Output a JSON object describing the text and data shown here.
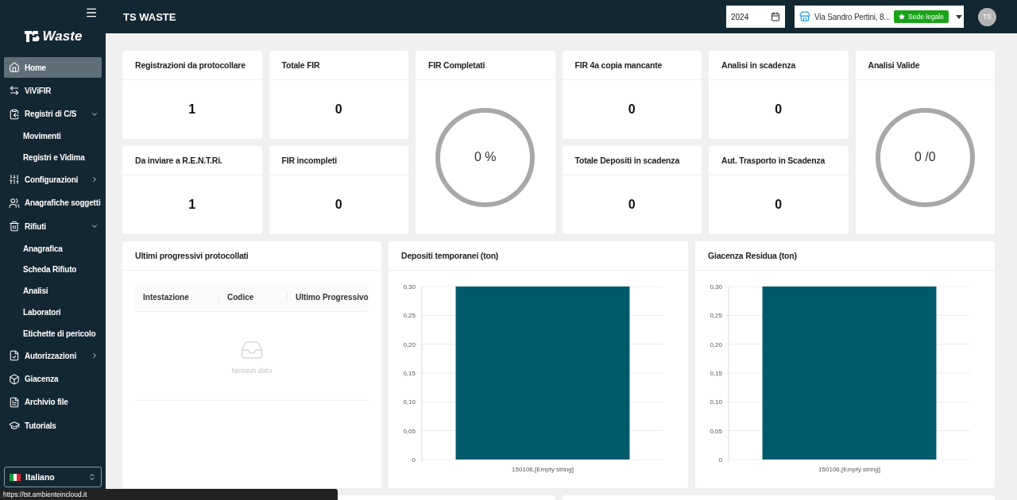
{
  "sidebar": {
    "logo": "Waste",
    "items": [
      {
        "label": "Home",
        "selected": true
      },
      {
        "label": "ViViFIR",
        "selected": false
      },
      {
        "label": "Registri di C/S",
        "selected": false,
        "expanded": true,
        "children": [
          {
            "label": "Movimenti",
            "selected": false
          },
          {
            "label": "Registri e Vidima",
            "selected": false
          }
        ]
      },
      {
        "label": "Configurazioni",
        "selected": false,
        "expanded": false
      },
      {
        "label": "Anagrafiche soggetti",
        "selected": false
      },
      {
        "label": "Rifiuti",
        "selected": false,
        "expanded": true,
        "children": [
          {
            "label": "Anagrafica",
            "selected": false
          },
          {
            "label": "Scheda Rifiuto",
            "selected": false
          },
          {
            "label": "Analisi",
            "selected": false
          },
          {
            "label": "Laboratori",
            "selected": false
          },
          {
            "label": "Etichette di pericolo",
            "selected": false
          }
        ]
      },
      {
        "label": "Autorizzazioni",
        "selected": false,
        "expanded": false
      },
      {
        "label": "Giacenza",
        "selected": false
      },
      {
        "label": "Archivio file",
        "selected": false
      },
      {
        "label": "Tutorials",
        "selected": false
      }
    ],
    "language": "Italiano"
  },
  "header": {
    "title": "TS WASTE",
    "year": "2024",
    "site": "Via Sandro Pertini, 8...",
    "site_badge": "Sede legale",
    "avatar": "TS"
  },
  "stats": [
    {
      "kind": "number",
      "title": "Registrazioni da protocollare",
      "value": "1"
    },
    {
      "kind": "number",
      "title": "Totale FIR",
      "value": "0"
    },
    {
      "kind": "gauge",
      "title": "FIR Completati",
      "value": "0 %"
    },
    {
      "kind": "number",
      "title": "FIR 4a copia mancante",
      "value": "0"
    },
    {
      "kind": "number",
      "title": "Analisi in scadenza",
      "value": "0"
    },
    {
      "kind": "gauge",
      "title": "Analisi Valide",
      "value": "0 /0"
    },
    {
      "kind": "number",
      "title": "Da inviare a R.E.N.T.Ri.",
      "value": "1"
    },
    {
      "kind": "number",
      "title": "FIR incompleti",
      "value": "0"
    },
    {
      "kind": "number",
      "title": "Totale Depositi in scadenza",
      "value": "0"
    },
    {
      "kind": "number",
      "title": "Aut. Trasporto in Scadenza",
      "value": "0"
    }
  ],
  "table_panel": {
    "title": "Ultimi progressivi protocollati",
    "columns": [
      "Intestazione",
      "Codice",
      "Ultimo Progressivo"
    ],
    "empty": "Nessun dato"
  },
  "chart_panels": [
    {
      "title": "Depositi temporanei (ton)",
      "chart_data": {
        "type": "bar",
        "grid": true,
        "categories": [
          "150106,[Empty string]"
        ],
        "series": [
          {
            "color": "#005a6b",
            "values": [
              0.3
            ]
          }
        ],
        "ylim": [
          0,
          0.3
        ],
        "yticks": [
          {
            "value": 0,
            "label": "0"
          },
          {
            "value": 0.05,
            "label": "0,05"
          },
          {
            "value": 0.1,
            "label": "0,10"
          },
          {
            "value": 0.15,
            "label": "0,15"
          },
          {
            "value": 0.2,
            "label": "0,20"
          },
          {
            "value": 0.25,
            "label": "0,25"
          },
          {
            "value": 0.3,
            "label": "0,30"
          }
        ]
      }
    },
    {
      "title": "Giacenza Residua (ton)",
      "chart_data": {
        "type": "bar",
        "grid": true,
        "categories": [
          "150106,[Empty string]"
        ],
        "series": [
          {
            "color": "#005a6b",
            "values": [
              0.3
            ]
          }
        ],
        "ylim": [
          0,
          0.3
        ],
        "yticks": [
          {
            "value": 0,
            "label": "0"
          },
          {
            "value": 0.05,
            "label": "0,05"
          },
          {
            "value": 0.1,
            "label": "0,10"
          },
          {
            "value": 0.15,
            "label": "0,15"
          },
          {
            "value": 0.2,
            "label": "0,20"
          },
          {
            "value": 0.25,
            "label": "0,25"
          },
          {
            "value": 0.3,
            "label": "0,30"
          }
        ]
      }
    }
  ],
  "status_url": "https://tst.ambienteincloud.it"
}
